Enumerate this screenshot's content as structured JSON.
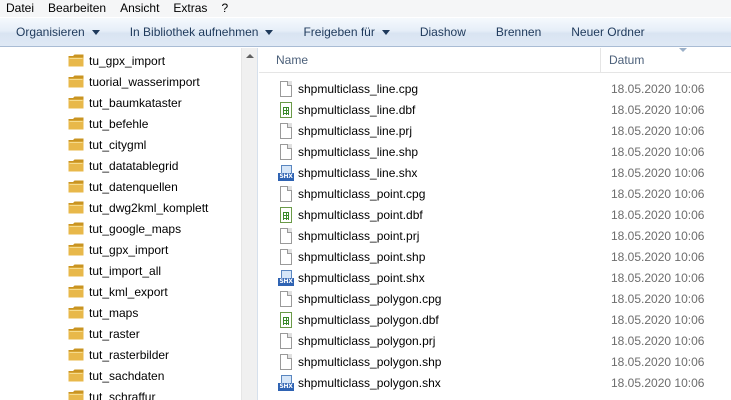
{
  "menu": [
    "Datei",
    "Bearbeiten",
    "Ansicht",
    "Extras",
    "?"
  ],
  "toolbar": [
    {
      "label": "Organisieren",
      "dropdown": true
    },
    {
      "label": "In Bibliothek aufnehmen",
      "dropdown": true
    },
    {
      "label": "Freigeben für",
      "dropdown": true
    },
    {
      "label": "Diashow",
      "dropdown": false
    },
    {
      "label": "Brennen",
      "dropdown": false
    },
    {
      "label": "Neuer Ordner",
      "dropdown": false
    }
  ],
  "nav": {
    "folders": [
      "tu_gpx_import",
      "tuorial_wasserimport",
      "tut_baumkataster",
      "tut_befehle",
      "tut_citygml",
      "tut_datatablegrid",
      "tut_datenquellen",
      "tut_dwg2kml_komplett",
      "tut_google_maps",
      "tut_gpx_import",
      "tut_import_all",
      "tut_kml_export",
      "tut_maps",
      "tut_raster",
      "tut_rasterbilder",
      "tut_sachdaten",
      "tut_schraffur"
    ]
  },
  "filelist": {
    "columns": {
      "name": "Name",
      "date": "Datum"
    },
    "files": [
      {
        "name": "shpmulticlass_line.cpg",
        "date": "18.05.2020 10:06",
        "icon": "file-icon"
      },
      {
        "name": "shpmulticlass_line.dbf",
        "date": "18.05.2020 10:06",
        "icon": "dbf-file-icon"
      },
      {
        "name": "shpmulticlass_line.prj",
        "date": "18.05.2020 10:06",
        "icon": "file-icon"
      },
      {
        "name": "shpmulticlass_line.shp",
        "date": "18.05.2020 10:06",
        "icon": "file-icon"
      },
      {
        "name": "shpmulticlass_line.shx",
        "date": "18.05.2020 10:06",
        "icon": "shx-file-icon"
      },
      {
        "name": "shpmulticlass_point.cpg",
        "date": "18.05.2020 10:06",
        "icon": "file-icon"
      },
      {
        "name": "shpmulticlass_point.dbf",
        "date": "18.05.2020 10:06",
        "icon": "dbf-file-icon"
      },
      {
        "name": "shpmulticlass_point.prj",
        "date": "18.05.2020 10:06",
        "icon": "file-icon"
      },
      {
        "name": "shpmulticlass_point.shp",
        "date": "18.05.2020 10:06",
        "icon": "file-icon"
      },
      {
        "name": "shpmulticlass_point.shx",
        "date": "18.05.2020 10:06",
        "icon": "shx-file-icon"
      },
      {
        "name": "shpmulticlass_polygon.cpg",
        "date": "18.05.2020 10:06",
        "icon": "file-icon"
      },
      {
        "name": "shpmulticlass_polygon.dbf",
        "date": "18.05.2020 10:06",
        "icon": "dbf-file-icon"
      },
      {
        "name": "shpmulticlass_polygon.prj",
        "date": "18.05.2020 10:06",
        "icon": "file-icon"
      },
      {
        "name": "shpmulticlass_polygon.shp",
        "date": "18.05.2020 10:06",
        "icon": "file-icon"
      },
      {
        "name": "shpmulticlass_polygon.shx",
        "date": "18.05.2020 10:06",
        "icon": "shx-file-icon"
      }
    ]
  },
  "icon_badge": "SHX",
  "colors": {
    "folder": "#e8b84a",
    "folder_dark": "#c99422",
    "toolbar_text": "#1e395b",
    "header_text": "#4c607a",
    "date_text": "#6d6d6d"
  }
}
